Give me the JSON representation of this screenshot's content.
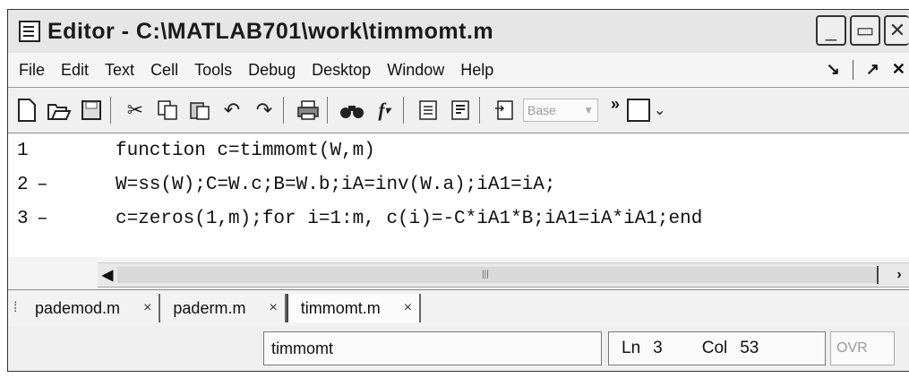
{
  "window": {
    "title": "Editor - C:\\MATLAB701\\work\\timmomt.m",
    "minimize": "_",
    "maximize": "▭",
    "close": "✕"
  },
  "menu": {
    "items": [
      "File",
      "Edit",
      "Text",
      "Cell",
      "Tools",
      "Debug",
      "Desktop",
      "Window",
      "Help"
    ],
    "dock_glyph": "↘",
    "undock_glyph": "↗",
    "close_glyph": "✕"
  },
  "toolbar": {
    "icons": [
      "new-file-icon",
      "open-file-icon",
      "save-icon",
      "cut-icon",
      "copy-icon",
      "paste-icon",
      "undo-icon",
      "redo-icon",
      "print-icon",
      "find-icon",
      "function-icon",
      "stack-icon",
      "cell-icon",
      "run-cell-icon"
    ],
    "stack_value": "Base",
    "overflow": "»"
  },
  "code": {
    "lines": [
      {
        "num": "1",
        "marker": "",
        "text": "function c=timmomt(W,m)"
      },
      {
        "num": "2",
        "marker": "–",
        "text": "W=ss(W);C=W.c;B=W.b;iA=inv(W.a);iA1=iA;"
      },
      {
        "num": "3",
        "marker": "–",
        "text": "c=zeros(1,m);for i=1:m, c(i)=-C*iA1*B;iA1=iA*iA1;end"
      }
    ]
  },
  "scrollbar": {
    "left": "◀",
    "right": "›",
    "grip": "|||"
  },
  "tabs": [
    {
      "label": "pademod.m",
      "close": "×"
    },
    {
      "label": "paderm.m",
      "close": "×"
    },
    {
      "label": "timmomt.m",
      "close": "×"
    }
  ],
  "status": {
    "function_name": "timmomt",
    "ln_label": "Ln",
    "ln_value": "3",
    "col_label": "Col",
    "col_value": "53",
    "ovr": "OVR"
  }
}
